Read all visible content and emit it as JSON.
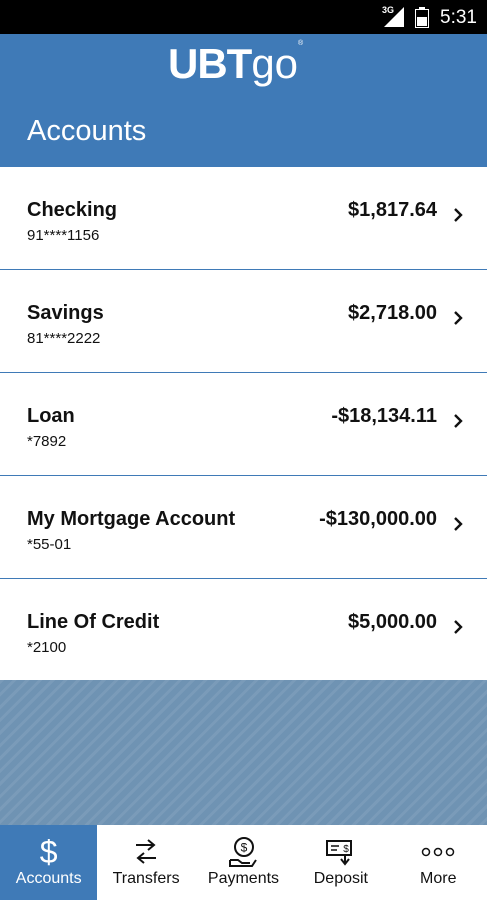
{
  "status_bar": {
    "network": "3G",
    "time": "5:31"
  },
  "header": {
    "logo_main": "UBT",
    "logo_go": "go",
    "logo_reg": "®",
    "title": "Accounts"
  },
  "accounts": [
    {
      "name": "Checking",
      "number": "91****1156",
      "balance": "$1,817.64"
    },
    {
      "name": "Savings",
      "number": "81****2222",
      "balance": "$2,718.00"
    },
    {
      "name": "Loan",
      "number": "*7892",
      "balance": "-$18,134.11"
    },
    {
      "name": "My Mortgage Account",
      "number": "*55-01",
      "balance": "-$130,000.00"
    },
    {
      "name": "Line Of Credit",
      "number": "*2100",
      "balance": "$5,000.00"
    }
  ],
  "nav": {
    "items": [
      {
        "label": "Accounts",
        "icon": "dollar-icon",
        "active": true
      },
      {
        "label": "Transfers",
        "icon": "transfer-arrows-icon"
      },
      {
        "label": "Payments",
        "icon": "hand-coin-icon"
      },
      {
        "label": "Deposit",
        "icon": "check-deposit-icon"
      },
      {
        "label": "More",
        "icon": "more-dots-icon"
      }
    ],
    "dollar_glyph": "$"
  },
  "colors": {
    "brand_blue": "#3f7ab7",
    "pattern_blue": "#6f93b3"
  }
}
